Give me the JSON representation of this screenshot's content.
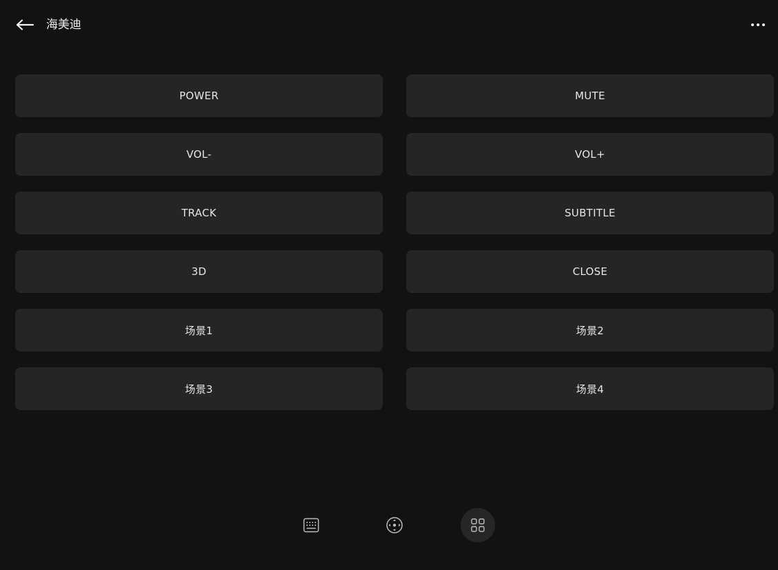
{
  "header": {
    "title": "海美迪",
    "back_icon": "arrow-left-icon",
    "more_icon": "more-horizontal-icon"
  },
  "keys": [
    {
      "label": "POWER"
    },
    {
      "label": "MUTE"
    },
    {
      "label": "VOL-"
    },
    {
      "label": "VOL+"
    },
    {
      "label": "TRACK"
    },
    {
      "label": "SUBTITLE"
    },
    {
      "label": "3D"
    },
    {
      "label": "CLOSE"
    },
    {
      "label": "场景1"
    },
    {
      "label": "场景2"
    },
    {
      "label": "场景3"
    },
    {
      "label": "场景4"
    }
  ],
  "bottom_tabs": [
    {
      "icon": "keyboard-icon",
      "active": false
    },
    {
      "icon": "dpad-icon",
      "active": false
    },
    {
      "icon": "grid-apps-icon",
      "active": true
    }
  ],
  "colors": {
    "background": "#121212",
    "key_background": "#252525",
    "text": "#e6e6e6",
    "active_tab_background": "#262626"
  }
}
